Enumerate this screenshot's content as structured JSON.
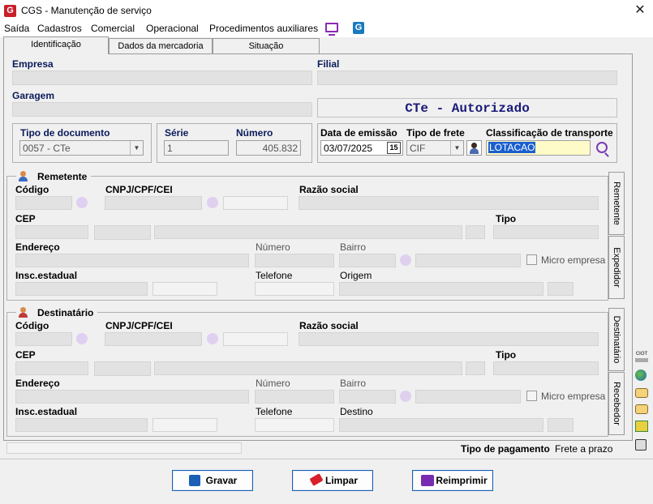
{
  "window": {
    "title": "CGS - Manutenção de serviço",
    "close": "✕"
  },
  "menu": [
    "Saída",
    "Cadastros",
    "Comercial",
    "Operacional",
    "Procedimentos auxiliares"
  ],
  "tabs": [
    "Identificação",
    "Dados da mercadoria",
    "Situação"
  ],
  "header": {
    "empresa_label": "Empresa",
    "filial_label": "Filial",
    "garagem_label": "Garagem",
    "status_text": "CTe - Autorizado",
    "tipo_documento_label": "Tipo de documento",
    "tipo_documento_value": "0057 - CTe",
    "serie_label": "Série",
    "serie_value": "1",
    "numero_label": "Número",
    "numero_value": "405.832",
    "data_emissao_label": "Data de emissão",
    "data_emissao_value": "03/07/2025",
    "calendar_icon": "15",
    "tipo_frete_label": "Tipo de frete",
    "tipo_frete_value": "CIF",
    "classificacao_label": "Classificação de transporte",
    "classificacao_value": "LOTACAO"
  },
  "remetente": {
    "title": "Remetente",
    "codigo": "Código",
    "cnpj": "CNPJ/CPF/CEI",
    "razao": "Razão social",
    "cep": "CEP",
    "tipo": "Tipo",
    "endereco": "Endereço",
    "numero": "Número",
    "bairro": "Bairro",
    "micro": "Micro empresa",
    "insc": "Insc.estadual",
    "telefone": "Telefone",
    "origem": "Origem"
  },
  "destinatario": {
    "title": "Destinatário",
    "codigo": "Código",
    "cnpj": "CNPJ/CPF/CEI",
    "razao": "Razão social",
    "cep": "CEP",
    "tipo": "Tipo",
    "endereco": "Endereço",
    "numero": "Número",
    "bairro": "Bairro",
    "micro": "Micro empresa",
    "insc": "Insc.estadual",
    "telefone": "Telefone",
    "destino": "Destino"
  },
  "vtabs": [
    "Remetente",
    "Expedidor",
    "Destinatário",
    "Recebedor"
  ],
  "side_label": "CIOT",
  "footer": {
    "tipo_pagamento_label": "Tipo de pagamento",
    "tipo_pagamento_value": "Frete a prazo"
  },
  "buttons": {
    "gravar": "Gravar",
    "limpar": "Limpar",
    "reimprimir": "Reimprimir"
  }
}
